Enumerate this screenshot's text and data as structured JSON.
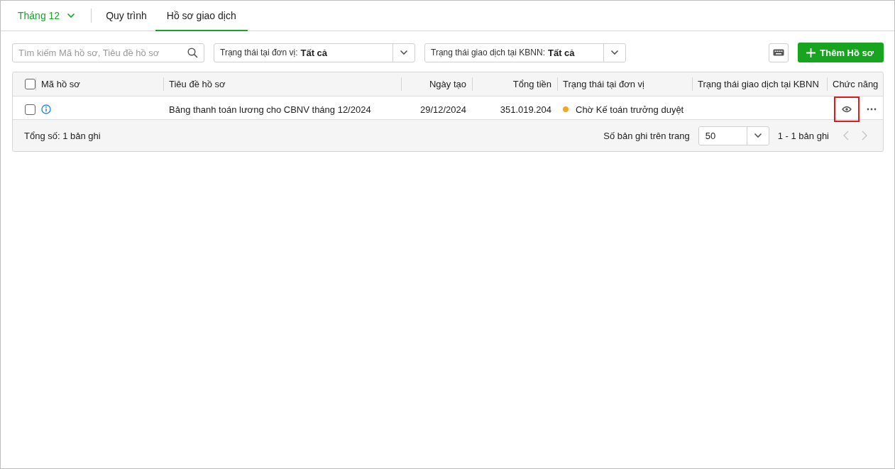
{
  "tabs": {
    "period": {
      "label": "Tháng 12"
    },
    "items": [
      {
        "label": "Quy trình",
        "selected": false
      },
      {
        "label": "Hồ sơ giao dịch",
        "selected": true
      }
    ]
  },
  "toolbar": {
    "search": {
      "placeholder": "Tìm kiếm Mã hồ sơ, Tiêu đề hồ sơ"
    },
    "filters": [
      {
        "label": "Trạng thái tại đơn vị:",
        "value": "Tất cả"
      },
      {
        "label": "Trạng thái giao dịch tại KBNN:",
        "value": "Tất cả"
      }
    ],
    "add_button": "Thêm Hồ sơ"
  },
  "table": {
    "select_all_checked": false,
    "columns": [
      "Mã hồ sơ",
      "Tiêu đề hồ sơ",
      "Ngày tạo",
      "Tổng tiền",
      "Trạng thái tại đơn vị",
      "Trạng thái giao dịch tại KBNN",
      "Chức năng"
    ],
    "rows": [
      {
        "checked": false,
        "title": "Bảng thanh toán lương cho CBNV tháng 12/2024",
        "date": "29/12/2024",
        "total": "351.019.204",
        "unit_status": {
          "label": "Chờ Kế toán trưởng duyệt",
          "color": "#f5a623"
        },
        "view_highlighted": true
      }
    ],
    "footer": {
      "total": "Tổng số: 1 bản ghi",
      "page_size_label": "Số bản ghi trên trang",
      "page_size": "50",
      "range": "1 - 1 bản ghi"
    }
  }
}
